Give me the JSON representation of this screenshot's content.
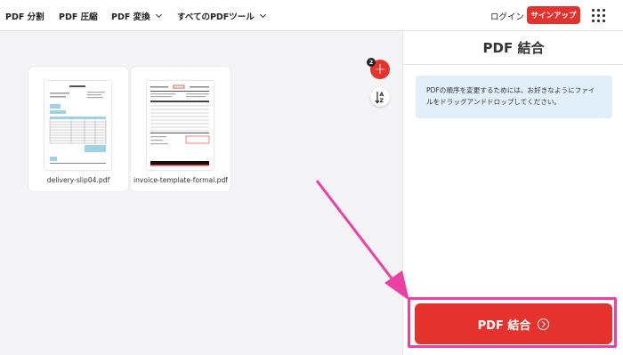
{
  "nav": {
    "items": [
      "PDF 分割",
      "PDF 圧縮",
      "PDF 変換",
      "すべてのPDFツール"
    ],
    "login": "ログイン",
    "signup": "サインアップ"
  },
  "files": [
    {
      "name": "delivery-slip04.pdf"
    },
    {
      "name": "invoice-template-formal.pdf"
    }
  ],
  "workspace": {
    "file_count_badge": "2",
    "add_symbol": "+",
    "sort_label": "A Z"
  },
  "sidebar": {
    "title": "PDF 結合",
    "info": "PDFの順序を変更するためには、お好きなようにファイルをドラッグアンドドロップしてください。",
    "merge_button": "PDF 結合"
  },
  "colors": {
    "accent": "#e5322d",
    "annotation": "#ee3fa2",
    "info_bg": "#e1effb"
  },
  "icons": [
    "chevron-down-icon",
    "apps-grid-icon",
    "plus-icon",
    "sort-az-icon",
    "arrow-right-circle-icon"
  ]
}
